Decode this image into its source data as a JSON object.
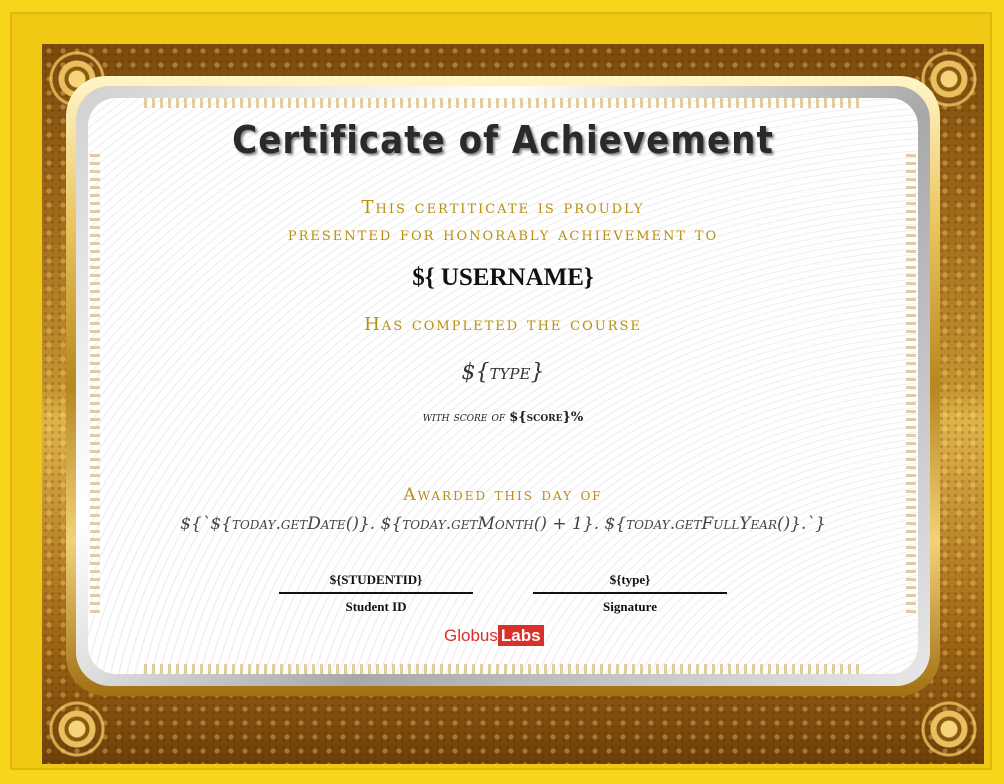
{
  "certificate": {
    "title": "Certificate of Achievement",
    "presented_line1": "This certiticate is proudly",
    "presented_line2": "presented for honorably achievement to",
    "username": "${ USERNAME}",
    "completed": "Has completed the course",
    "type": "${type}",
    "score_prefix": "with score of ",
    "score_value": "${score}",
    "score_suffix": "%",
    "awarded": "Awarded this day of",
    "date": "${`${today.getDate()}. ${today.getMonth() + 1}. ${today.getFullYear()}.`}"
  },
  "signatures": {
    "student_value": "${STUDENTID}",
    "student_label": "Student ID",
    "signature_value": "${type}",
    "signature_label": "Signature"
  },
  "logo": {
    "part1": "Globus",
    "part2": "Labs"
  },
  "colors": {
    "background": "#f6d51b",
    "gold_text": "#b8900e",
    "frame_brown": "#8a5a12",
    "logo_red": "#d9302a"
  }
}
